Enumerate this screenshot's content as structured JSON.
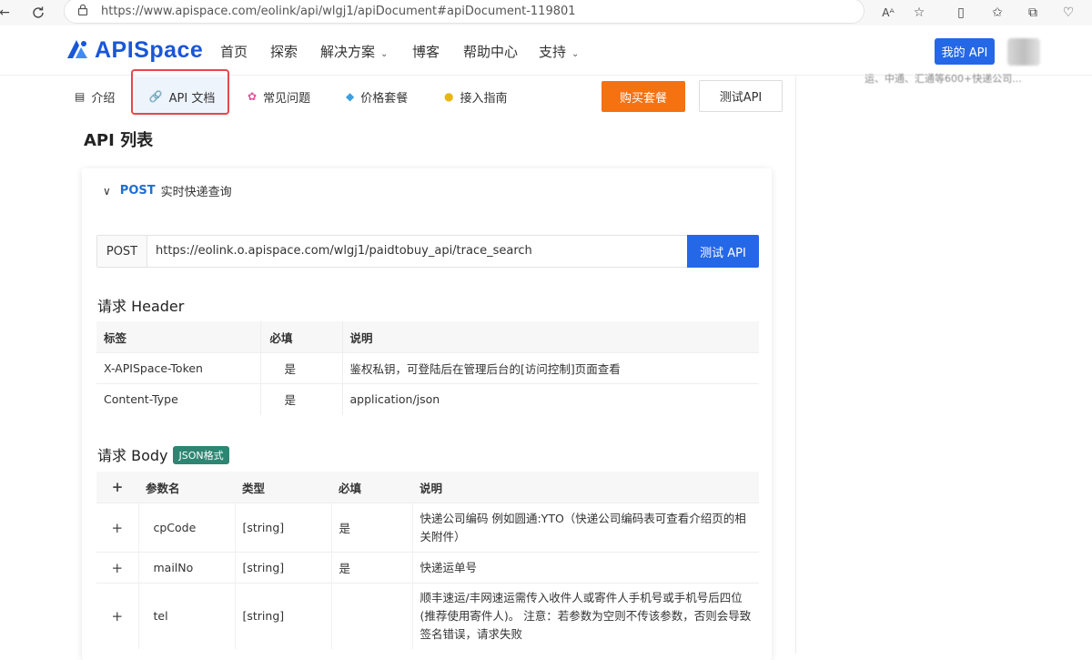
{
  "browser": {
    "url": "https://www.apispace.com/eolink/api/wlgj1/apiDocument#apiDocument-119801",
    "icons": [
      "back-icon",
      "refresh-icon",
      "lock-icon",
      "read-aloud-icon",
      "favorite-icon",
      "split-screen-icon",
      "favorites-icon",
      "collections-icon",
      "performance-icon"
    ]
  },
  "header": {
    "logo_text": "APISpace",
    "nav": [
      {
        "label": "首页"
      },
      {
        "label": "探索"
      },
      {
        "label": "解决方案",
        "chevron": "⌄"
      },
      {
        "label": "博客"
      },
      {
        "label": "帮助中心"
      },
      {
        "label": "支持",
        "chevron": "⌄"
      }
    ],
    "my_api_label": "我的 API",
    "right_snippet": "运、中通、汇通等600+快递公司..."
  },
  "tabs": [
    {
      "label": "介绍",
      "icon": "document-icon"
    },
    {
      "label": "API 文档",
      "icon": "link-icon"
    },
    {
      "label": "常见问题",
      "icon": "flower-icon"
    },
    {
      "label": "价格套餐",
      "icon": "diamond-icon"
    },
    {
      "label": "接入指南",
      "icon": "lightbulb-icon"
    }
  ],
  "actions": {
    "buy_label": "购买套餐",
    "test_label": "测试API"
  },
  "api_list_title": "API 列表",
  "endpoint": {
    "method": "POST",
    "name": "实时快递查询",
    "url_method": "POST",
    "url": "https://eolink.o.apispace.com/wlgj1/paidtobuy_api/trace_search",
    "test_button": "测试 API"
  },
  "request_header": {
    "title": "请求 Header",
    "columns": [
      "标签",
      "必填",
      "说明"
    ],
    "rows": [
      [
        "X-APISpace-Token",
        "是",
        "鉴权私钥，可登陆后在管理后台的[访问控制]页面查看"
      ],
      [
        "Content-Type",
        "是",
        "application/json"
      ]
    ]
  },
  "request_body": {
    "title": "请求 Body",
    "badge": "JSON格式",
    "columns": [
      "+",
      "参数名",
      "类型",
      "必填",
      "说明"
    ],
    "rows": [
      [
        "+",
        "cpCode",
        "[string]",
        "是",
        "快递公司编码 例如圆通:YTO（快递公司编码表可查看介绍页的相关附件）"
      ],
      [
        "+",
        "mailNo",
        "[string]",
        "是",
        "快递运单号"
      ],
      [
        "+",
        "tel",
        "[string]",
        "",
        "顺丰速运/丰网速运需传入收件人或寄件人手机号或手机号后四位(推荐使用寄件人)。 注意：若参数为空则不传该参数，否则会导致签名错误，请求失败"
      ]
    ]
  },
  "colors": {
    "accent": "#2468e8",
    "buy": "#f67110",
    "badge": "#2e8572",
    "highlight": "#e5484d",
    "post": "#1f6fd1"
  }
}
